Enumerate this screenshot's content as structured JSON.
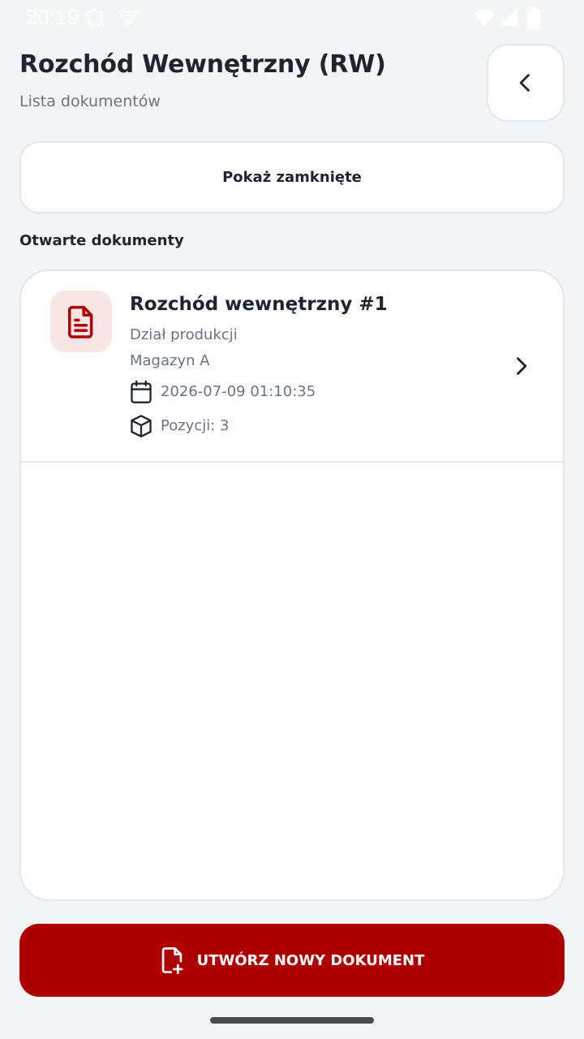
{
  "status_bar": {
    "time": "20:19",
    "icons": [
      "shield-icon",
      "vpn-icon",
      "wifi-icon",
      "signal-icon",
      "battery-icon"
    ]
  },
  "header": {
    "title": "Rozchód Wewnętrzny (RW)",
    "subtitle": "Lista dokumentów",
    "back_icon": "chevron-left-icon"
  },
  "toggle_closed_label": "Pokaż zamknięte",
  "section_heading": "Otwarte dokumenty",
  "documents": [
    {
      "icon": "document-icon",
      "title": "Rozchód wewnętrzny #1",
      "department": "Dział produkcji",
      "warehouse": "Magazyn A",
      "date": "2026-07-09 01:10:35",
      "positions": "Pozycji: 3"
    }
  ],
  "create_button": {
    "label": "UTWÓRZ NOWY DOKUMENT",
    "icon": "file-plus-icon"
  },
  "colors": {
    "accent": "#ad0000",
    "accent_soft": "#f7e4e5",
    "background": "#f4f5f7",
    "muted_text": "#6b7285"
  }
}
